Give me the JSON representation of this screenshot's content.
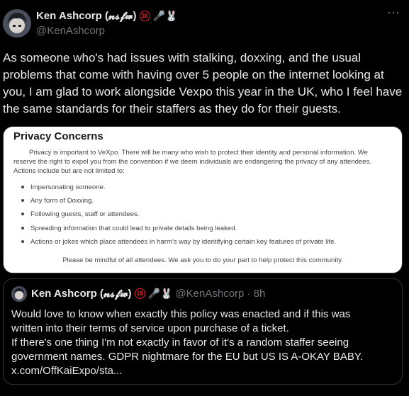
{
  "tweet": {
    "author_name": "Ken Ashcorp (𝓷𝓼𝓯𝔀)",
    "badge_18": "18",
    "emoji": "🎤🐰",
    "handle": "@KenAshcorp",
    "more_label": "···",
    "text": "As someone who's had issues with stalking, doxxing, and the usual problems that come with having over 5 people on the internet looking at you, I am glad to work alongside Vexpo this year in the UK, who I feel have the same standards for their staffers as they do for their guests."
  },
  "image_card": {
    "title": "Privacy Concerns",
    "intro": "Privacy is important to VeXpo. There will be many who wish to protect their identity and personal information. We reserve the right to expel you from the convention if we deem individuals are endangering the privacy of any attendees. Actions include but are not limited to:",
    "items": [
      "Impersonating someone.",
      "Any form of Doxxing.",
      "Following guests, staff or attendees.",
      "Spreading information that could lead to private details being leaked.",
      "Actions or jokes which place attendees in harm's way by identifying certain key features of private life."
    ],
    "footer": "Please be mindful of all attendees. We ask you to do your part to help protect this community."
  },
  "quote": {
    "author_name": "Ken Ashcorp (𝓷𝓼𝓯𝔀)",
    "badge_18": "18",
    "emoji": "🎤🐰",
    "handle_time": "@KenAshcorp · 8h",
    "lines": [
      "Would love to know when exactly this policy was enacted and if this was",
      "written into their terms of service upon purchase of a ticket.",
      "If there's one thing I'm not exactly in favor of it's a random staffer seeing",
      "government names. GDPR nightmare for the EU but US IS A-OKAY BABY.",
      "x.com/OffKaiExpo/sta..."
    ]
  },
  "colors": {
    "background": "#000000",
    "text": "#e7e9ea",
    "secondary": "#71767b",
    "border": "#2f3336",
    "badge": "#f4212e"
  }
}
